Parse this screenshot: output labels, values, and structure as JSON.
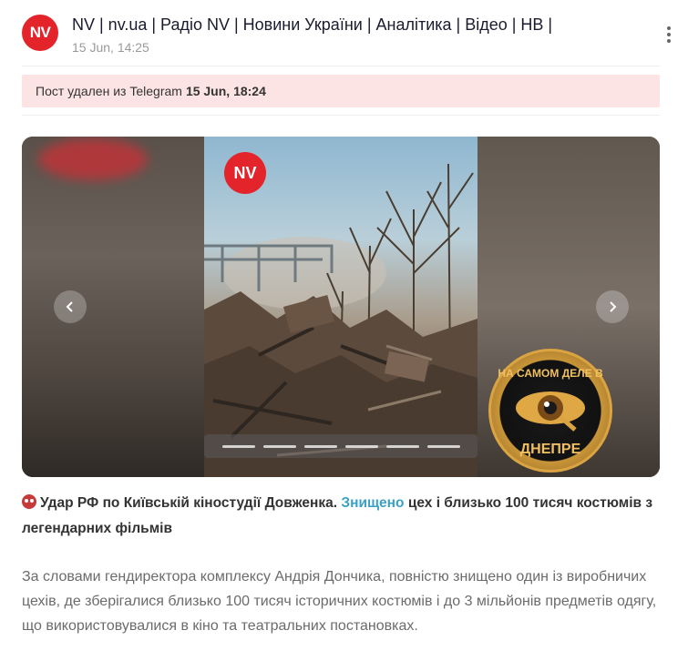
{
  "header": {
    "avatar_text": "NV",
    "channel_title": "NV | nv.ua | Радіо NV | Новини України | Аналітика | Відео | НВ |",
    "date": "15 Jun, 14:25"
  },
  "banner": {
    "text": "Пост удален из Telegram",
    "deleted_time": "15 Jun, 18:24"
  },
  "gallery": {
    "logo_text": "NV",
    "slide_count": 6,
    "watermark": "НА САМОМ ДЕЛЕ В ДНЕПРЕ"
  },
  "post": {
    "headline_prefix": "Удар РФ по Київській кіностудії Довженка.",
    "headline_link": "Знищено",
    "headline_suffix": "цех і близько 100 тисяч костюмів з легендарних фільмів",
    "body": "За словами гендиректора комплексу Андрія Дончика, повністю знищено один із виробничих цехів, де зберігалися близько 100 тисяч історичних костюмів і до 3 мільйонів предметів одягу, що використовувалися в кіно та театральних постановках."
  },
  "colors": {
    "brand_red": "#e3242b",
    "banner_bg": "#fde4e4",
    "link": "#3aa0c6"
  },
  "icons": [
    "more-vertical-icon",
    "chevron-left-icon",
    "chevron-right-icon",
    "angry-face-icon"
  ]
}
